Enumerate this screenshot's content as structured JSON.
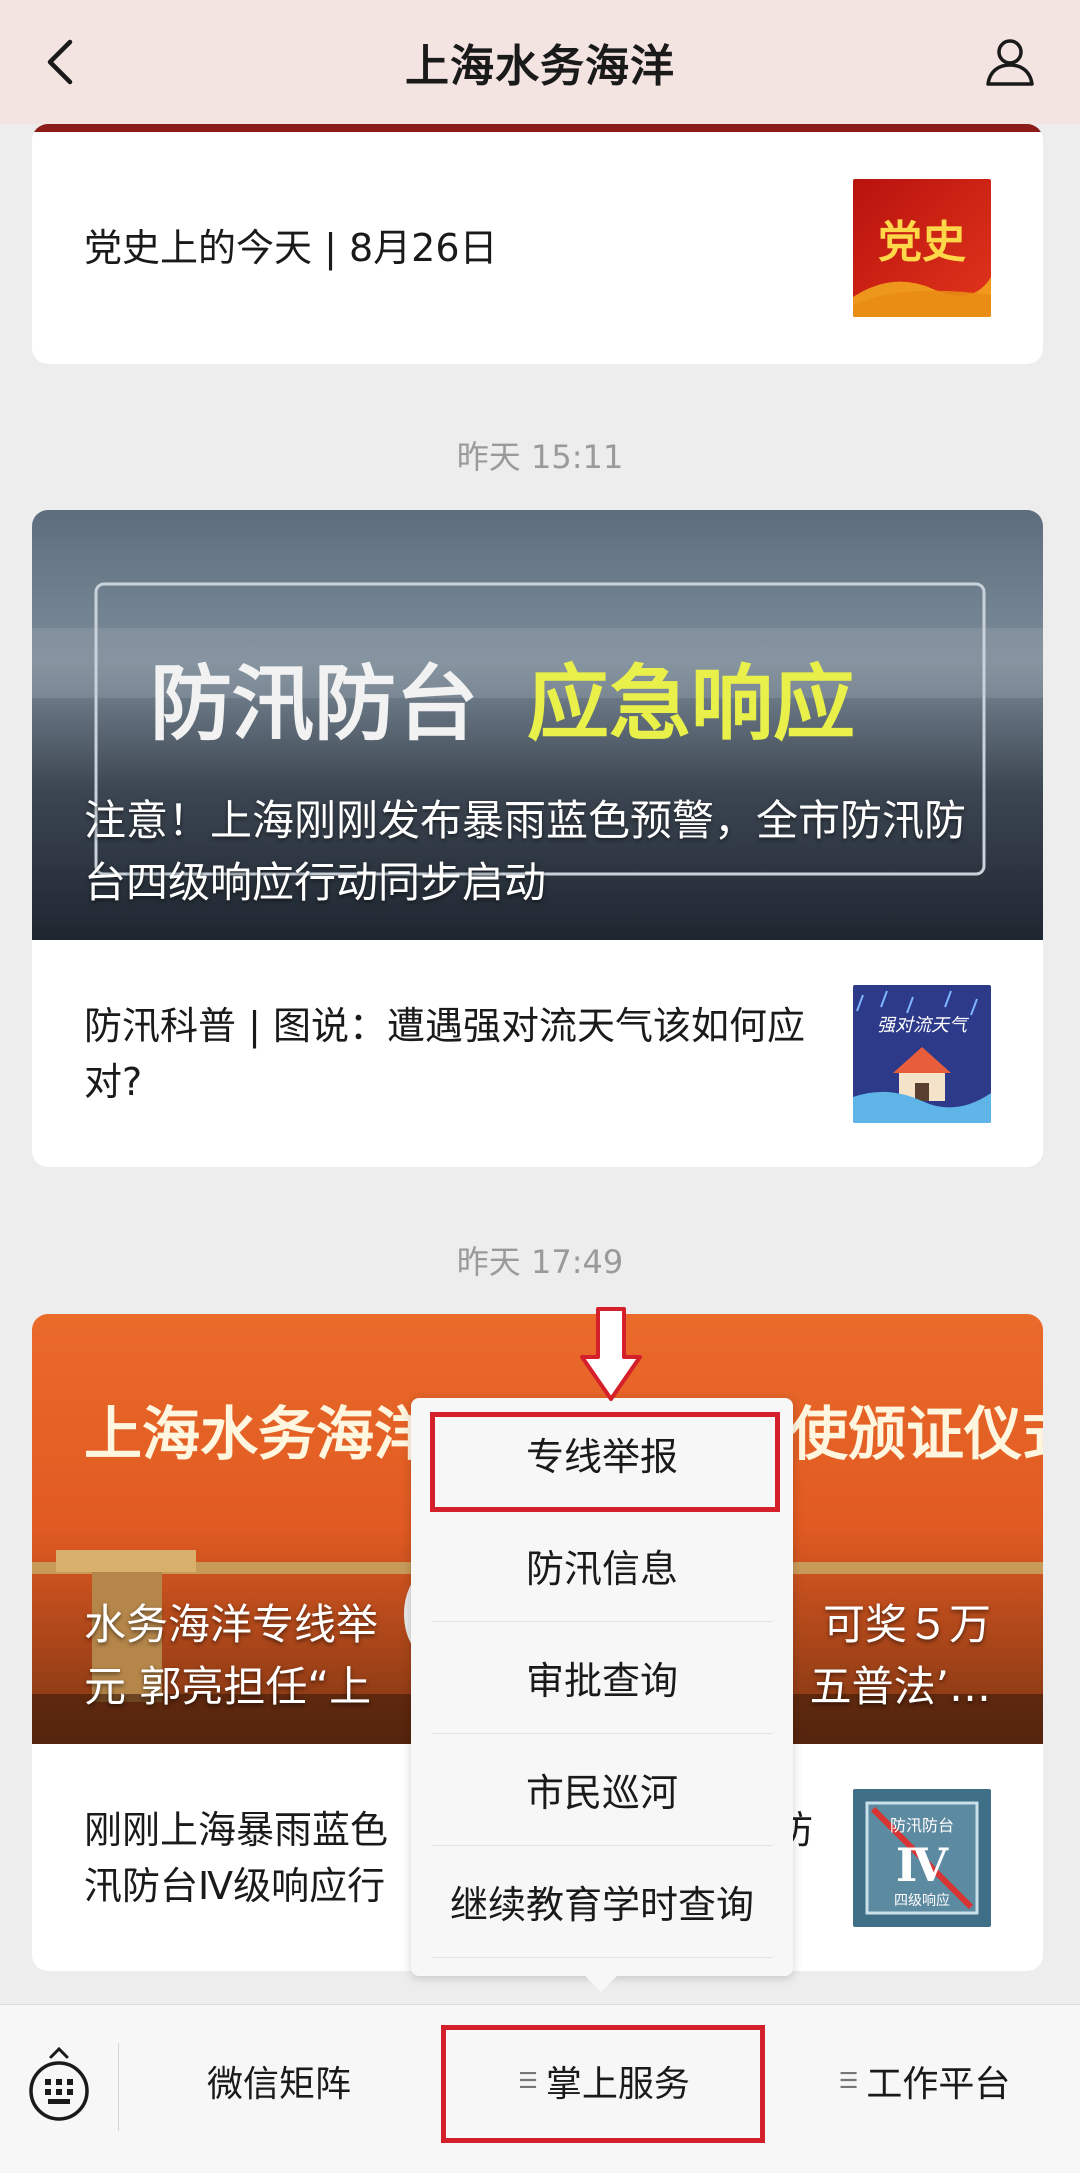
{
  "header": {
    "title": "上海水务海洋"
  },
  "feed": {
    "card1": {
      "title": "党史上的今天 | 8月26日",
      "thumb_text": "党史"
    },
    "time1": "昨天 15:11",
    "card2": {
      "hero_banner_left": "防汛防台",
      "hero_banner_right": "应急响应",
      "hero_caption": "注意！上海刚刚发布暴雨蓝色预警，全市防汛防台四级响应行动同步启动",
      "row_title": "防汛科普 | 图说：遭遇强对流天气该如何应对?",
      "thumb_text": "强对流天气"
    },
    "time2": "昨天 17:49",
    "card3": {
      "hero_banner": "上海水务海洋执法",
      "hero_banner_tail": "大使颁证仪式",
      "hero_caption_line1_left": "水务海洋专线举",
      "hero_caption_line1_right": "可奖５万",
      "hero_caption_line2_left": "元 郭亮担任“上",
      "hero_caption_line2_right": "五普法’…",
      "row_title_line1_left": "刚刚上海暴雨蓝色",
      "row_title_line1_right": "防",
      "row_title_line2_left": "汛防台Ⅳ级响应行",
      "thumb_text_top": "防汛防台",
      "thumb_text_mid": "Ⅳ",
      "thumb_text_bottom": "四级响应"
    }
  },
  "popup_menu": {
    "items": [
      "专线举报",
      "防汛信息",
      "审批查询",
      "市民巡河",
      "继续教育学时查询"
    ]
  },
  "bottom_bar": {
    "items": [
      "微信矩阵",
      "掌上服务",
      "工作平台"
    ]
  },
  "colors": {
    "header_bg": "#f3e4e2",
    "annotation_red": "#d4202a",
    "page_bg": "#ededed"
  }
}
